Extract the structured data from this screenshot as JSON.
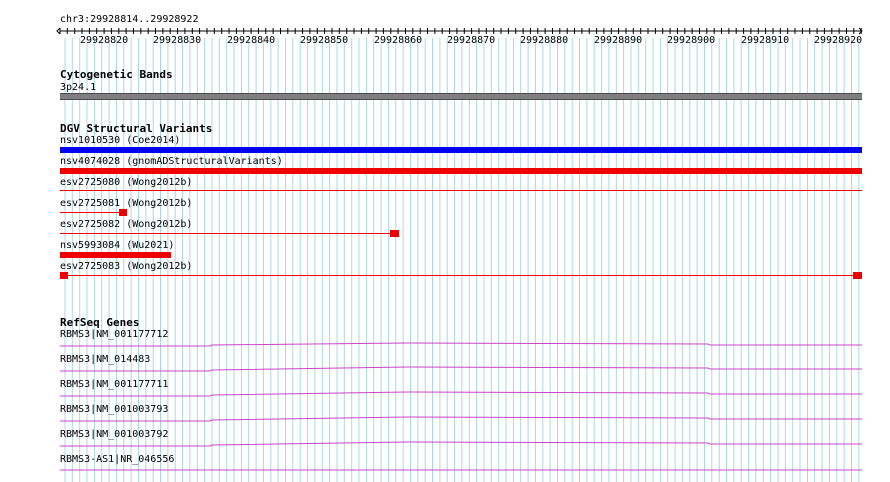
{
  "ruler": {
    "locus": "chr3:29928814..29928922",
    "ticks": [
      "29928820",
      "29928830",
      "29928840",
      "29928850",
      "29928860",
      "29928870",
      "29928880",
      "29928890",
      "29928900",
      "29928910",
      "29928920"
    ]
  },
  "tracks": {
    "cytoband": {
      "title": "Cytogenetic Bands",
      "band": "3p24.1"
    },
    "dgv": {
      "title": "DGV Structural Variants",
      "features": [
        {
          "label": "nsv1010530 (Coe2014)",
          "color": "#0000ee"
        },
        {
          "label": "nsv4074028 (gnomADStructuralVariants)",
          "color": "#ee0000"
        },
        {
          "label": "esv2725080 (Wong2012b)",
          "color": "#ee0000"
        },
        {
          "label": "esv2725081 (Wong2012b)",
          "color": "#ee0000"
        },
        {
          "label": "esv2725082 (Wong2012b)",
          "color": "#ee0000"
        },
        {
          "label": "nsv5993084 (Wu2021)",
          "color": "#ee0000"
        },
        {
          "label": "esv2725083 (Wong2012b)",
          "color": "#ee0000"
        }
      ]
    },
    "refseq": {
      "title": "RefSeq Genes",
      "genes": [
        {
          "label": "RBMS3|NM_001177712"
        },
        {
          "label": "RBMS3|NM_014483"
        },
        {
          "label": "RBMS3|NM_001177711"
        },
        {
          "label": "RBMS3|NM_001003793"
        },
        {
          "label": "RBMS3|NM_001003792"
        },
        {
          "label": "RBMS3-AS1|NR_046556"
        }
      ],
      "color": "#cc44cc"
    }
  },
  "colors": {
    "grid": "#a8d8e4",
    "cytoband": "#7f7f7f"
  }
}
